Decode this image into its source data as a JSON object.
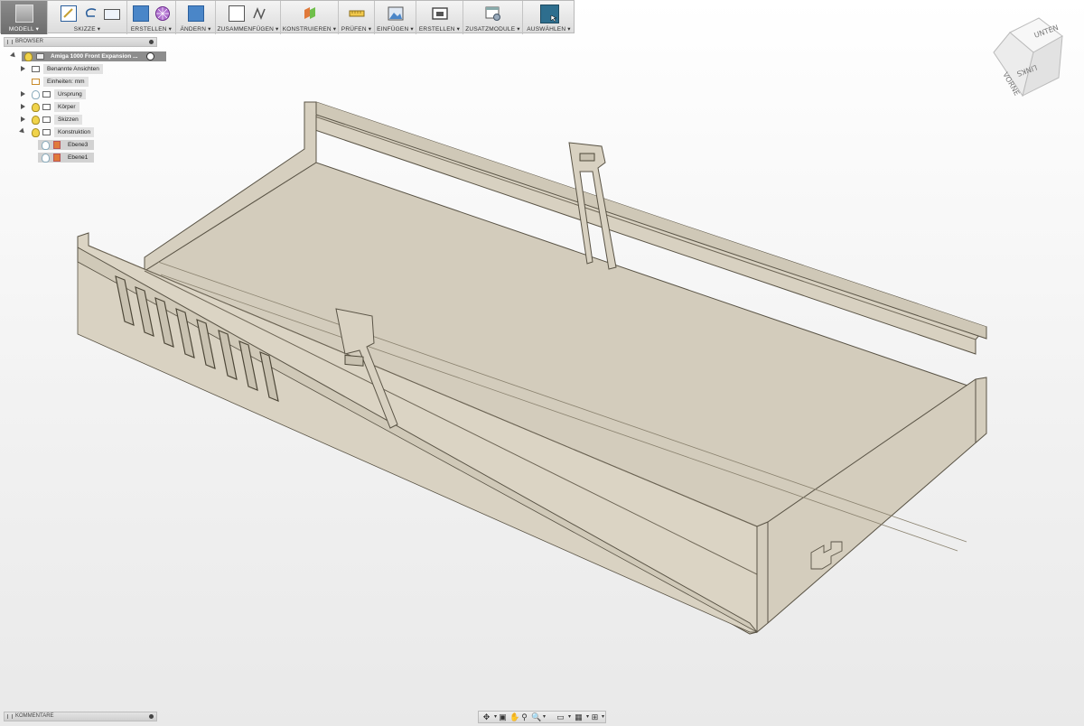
{
  "toolbar": {
    "groups": [
      {
        "label": "MODELL ▾"
      },
      {
        "label": "SKIZZE ▾"
      },
      {
        "label": "ERSTELLEN ▾"
      },
      {
        "label": "ÄNDERN ▾"
      },
      {
        "label": "ZUSAMMENFÜGEN ▾"
      },
      {
        "label": "KONSTRUIEREN ▾"
      },
      {
        "label": "PRÜFEN ▾"
      },
      {
        "label": "EINFÜGEN ▾"
      },
      {
        "label": "ERSTELLEN ▾"
      },
      {
        "label": "ZUSATZMODULE ▾"
      },
      {
        "label": "AUSWÄHLEN ▾"
      }
    ]
  },
  "browser": {
    "title": "BROWSER",
    "root": "Amiga 1000 Front Expansion ...",
    "items": [
      {
        "label": "Benannte Ansichten"
      },
      {
        "label": "Einheiten: mm"
      },
      {
        "label": "Ursprung"
      },
      {
        "label": "Körper"
      },
      {
        "label": "Skizzen"
      },
      {
        "label": "Konstruktion"
      },
      {
        "label": "Ebene3"
      },
      {
        "label": "Ebene1"
      }
    ]
  },
  "comments": {
    "title": "KOMMENTARE"
  },
  "viewcube": {
    "top": "UNTEN",
    "front": "VORNE",
    "side": "LINKS"
  },
  "colors": {
    "model_fill": "#d6cfbe",
    "model_edge": "#5a5446",
    "accent_select": "#2e6e8e",
    "bulb": "#f0d34a"
  }
}
